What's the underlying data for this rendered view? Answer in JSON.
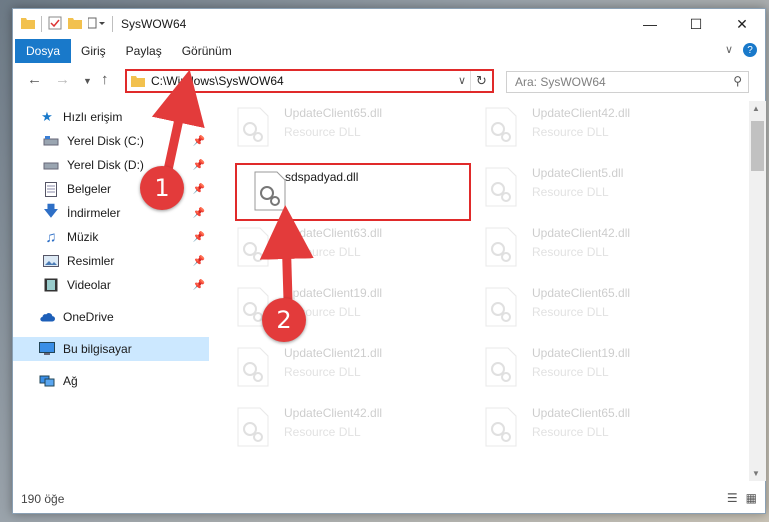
{
  "window": {
    "title": "SysWOW64"
  },
  "ribbon": {
    "tabs": [
      "Dosya",
      "Giriş",
      "Paylaş",
      "Görünüm"
    ]
  },
  "address": {
    "path": "C:\\Windows\\SysWOW64"
  },
  "search": {
    "placeholder": "Ara: SysWOW64"
  },
  "sidebar": {
    "items": [
      {
        "label": "Hızlı erişim",
        "icon": "star-icon"
      },
      {
        "label": "Yerel Disk (C:)",
        "icon": "drive-icon"
      },
      {
        "label": "Yerel Disk (D:)",
        "icon": "drive-icon"
      },
      {
        "label": "Belgeler",
        "icon": "document-icon"
      },
      {
        "label": "İndirmeler",
        "icon": "download-icon"
      },
      {
        "label": "Müzik",
        "icon": "music-icon"
      },
      {
        "label": "Resimler",
        "icon": "pictures-icon"
      },
      {
        "label": "Videolar",
        "icon": "video-icon"
      },
      {
        "label": "OneDrive",
        "icon": "cloud-icon"
      },
      {
        "label": "Bu bilgisayar",
        "icon": "computer-icon"
      },
      {
        "label": "Ağ",
        "icon": "network-icon"
      }
    ]
  },
  "files": [
    {
      "name": "UpdateClient65.dll",
      "type": "Resource DLL"
    },
    {
      "name": "UpdateClient42.dll",
      "type": "Resource DLL"
    },
    {
      "name": "sdspadyad.dll",
      "type": ""
    },
    {
      "name": "UpdateClient5.dll",
      "type": "Resource DLL"
    },
    {
      "name": "UpdateClient63.dll",
      "type": "Resource DLL"
    },
    {
      "name": "UpdateClient42.dll",
      "type": "Resource DLL"
    },
    {
      "name": "UpdateClient19.dll",
      "type": "Resource DLL"
    },
    {
      "name": "UpdateClient65.dll",
      "type": "Resource DLL"
    },
    {
      "name": "UpdateClient21.dll",
      "type": "Resource DLL"
    },
    {
      "name": "UpdateClient19.dll",
      "type": "Resource DLL"
    },
    {
      "name": "UpdateClient42.dll",
      "type": "Resource DLL"
    },
    {
      "name": "UpdateClient65.dll",
      "type": "Resource DLL"
    }
  ],
  "status": {
    "item_count": "190 öğe"
  },
  "annotations": {
    "step1": "1",
    "step2": "2"
  },
  "colors": {
    "accent": "#1979ca",
    "highlight_red": "#e02a2a",
    "selected": "#cce8ff"
  }
}
